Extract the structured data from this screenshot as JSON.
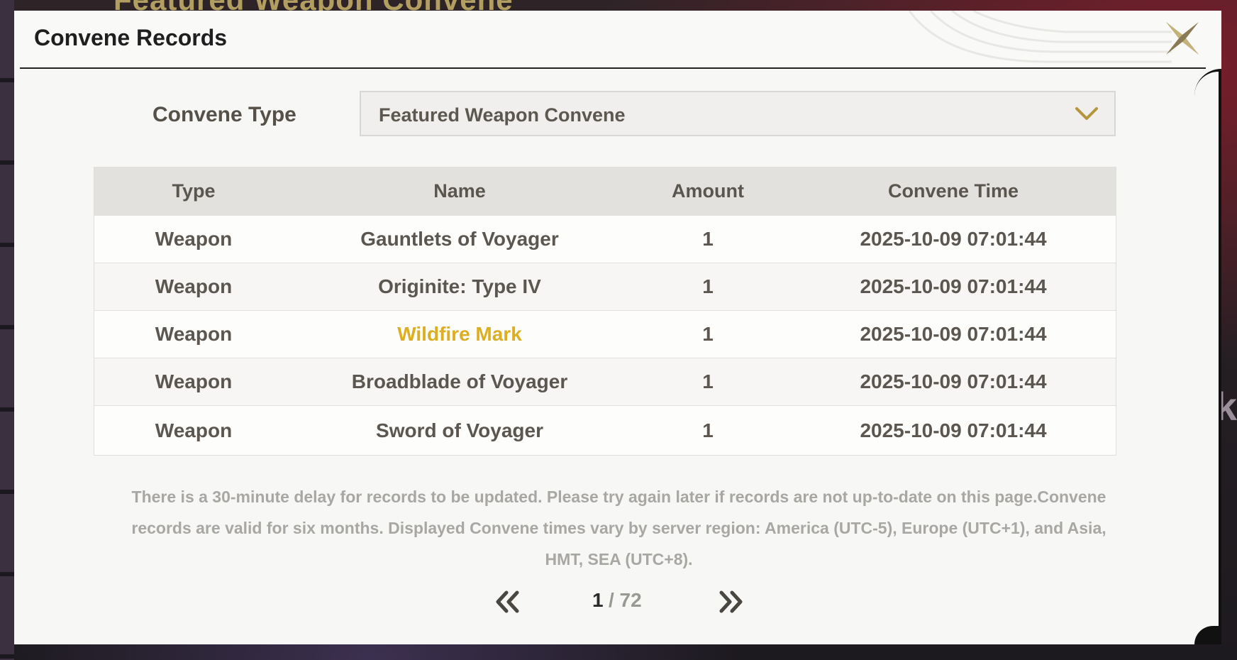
{
  "background": {
    "title": "Featured Weapon Convene"
  },
  "dialog": {
    "title": "Convene Records",
    "close_icon": "close-x-icon"
  },
  "filter": {
    "label": "Convene Type",
    "selected": "Featured Weapon Convene",
    "chevron_icon": "chevron-down-icon"
  },
  "table": {
    "headers": [
      "Type",
      "Name",
      "Amount",
      "Convene Time"
    ],
    "rows": [
      {
        "type": "Weapon",
        "name": "Gauntlets of Voyager",
        "amount": "1",
        "time": "2025-10-09 07:01:44"
      },
      {
        "type": "Weapon",
        "name": "Originite: Type IV",
        "amount": "1",
        "time": "2025-10-09 07:01:44"
      },
      {
        "type": "Weapon",
        "name": "Wildfire Mark",
        "amount": "1",
        "time": "2025-10-09 07:01:44",
        "highlight": "#dcae22"
      },
      {
        "type": "Weapon",
        "name": "Broadblade of Voyager",
        "amount": "1",
        "time": "2025-10-09 07:01:44"
      },
      {
        "type": "Weapon",
        "name": "Sword of Voyager",
        "amount": "1",
        "time": "2025-10-09 07:01:44"
      }
    ]
  },
  "note": "There is a 30-minute delay for records to be updated. Please try again later if records are not up-to-date on this page.Convene records are valid for six months. Displayed Convene times vary by server region: America (UTC-5), Europe (UTC+1), and Asia, HMT, SEA (UTC+8).",
  "pagination": {
    "current": "1",
    "total_text": " / 72",
    "prev_icon": "double-chevron-left-icon",
    "next_icon": "double-chevron-right-icon"
  },
  "colors": {
    "accent_gold": "#b5963c",
    "highlight": "#dcae22",
    "text_primary": "#5b564f"
  }
}
